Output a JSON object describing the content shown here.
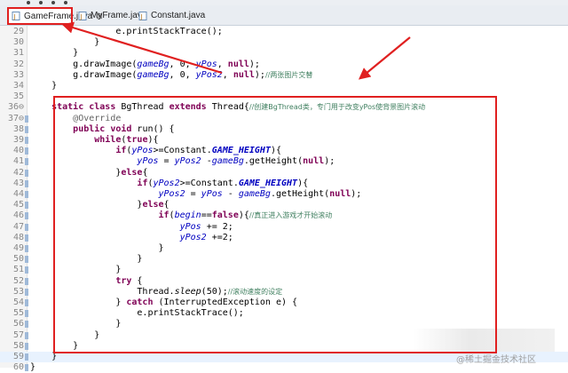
{
  "tabs": [
    {
      "label": "GameFrame.java",
      "close": "⊠",
      "active": true
    },
    {
      "label": "MyFrame.java",
      "active": false
    },
    {
      "label": "Constant.java",
      "active": false
    }
  ],
  "lines": [
    {
      "num": "29",
      "code": [
        [
          "",
          "                e.printStackTrace();"
        ]
      ]
    },
    {
      "num": "30",
      "code": [
        [
          "",
          "            }"
        ]
      ]
    },
    {
      "num": "31",
      "code": [
        [
          "",
          "        }"
        ]
      ]
    },
    {
      "num": "32",
      "code": [
        [
          "",
          "        g.drawImage("
        ],
        [
          "fld",
          "gameBg"
        ],
        [
          "",
          ", 0, "
        ],
        [
          "fld",
          "yPos"
        ],
        [
          "",
          ", "
        ],
        [
          "kw",
          "null"
        ],
        [
          "",
          ");"
        ]
      ]
    },
    {
      "num": "33",
      "code": [
        [
          "",
          "        g.drawImage("
        ],
        [
          "fld",
          "gameBg"
        ],
        [
          "",
          ", 0, "
        ],
        [
          "fld",
          "yPos2"
        ],
        [
          "",
          ", "
        ],
        [
          "kw",
          "null"
        ],
        [
          "",
          ");"
        ],
        [
          "cmt",
          "//两张图片交替"
        ]
      ]
    },
    {
      "num": "34",
      "code": [
        [
          "",
          "    }"
        ]
      ]
    },
    {
      "num": "35",
      "code": [
        [
          "",
          ""
        ]
      ]
    },
    {
      "num": "36⊖",
      "code": [
        [
          "",
          "    "
        ],
        [
          "kw",
          "static class"
        ],
        [
          "",
          " BgThread "
        ],
        [
          "kw",
          "extends"
        ],
        [
          "",
          " Thread{"
        ],
        [
          "cmt",
          "//创建BgThread类，专门用于改变yPos使背景图片滚动"
        ]
      ]
    },
    {
      "num": "37⊖",
      "code": [
        [
          "",
          "        "
        ],
        [
          "ann",
          "@Override"
        ]
      ]
    },
    {
      "num": "38",
      "code": [
        [
          "",
          "        "
        ],
        [
          "kw",
          "public void"
        ],
        [
          "",
          " run() {"
        ]
      ]
    },
    {
      "num": "39",
      "code": [
        [
          "",
          "            "
        ],
        [
          "kw",
          "while"
        ],
        [
          "",
          "("
        ],
        [
          "kw",
          "true"
        ],
        [
          "",
          "){"
        ]
      ]
    },
    {
      "num": "40",
      "code": [
        [
          "",
          "                "
        ],
        [
          "kw",
          "if"
        ],
        [
          "",
          "("
        ],
        [
          "fld",
          "yPos"
        ],
        [
          "",
          ">=Constant."
        ],
        [
          "sfld",
          "GAME_HEIGHT"
        ],
        [
          "",
          "){"
        ]
      ]
    },
    {
      "num": "41",
      "code": [
        [
          "",
          "                    "
        ],
        [
          "fld",
          "yPos"
        ],
        [
          "",
          " = "
        ],
        [
          "fld",
          "yPos2"
        ],
        [
          "",
          " -"
        ],
        [
          "fld",
          "gameBg"
        ],
        [
          "",
          ".getHeight("
        ],
        [
          "kw",
          "null"
        ],
        [
          "",
          ");"
        ]
      ]
    },
    {
      "num": "42",
      "code": [
        [
          "",
          "                }"
        ],
        [
          "kw",
          "else"
        ],
        [
          "",
          "{"
        ]
      ]
    },
    {
      "num": "43",
      "code": [
        [
          "",
          "                    "
        ],
        [
          "kw",
          "if"
        ],
        [
          "",
          "("
        ],
        [
          "fld",
          "yPos2"
        ],
        [
          "",
          ">=Constant."
        ],
        [
          "sfld",
          "GAME_HEIGHT"
        ],
        [
          "",
          "){"
        ]
      ]
    },
    {
      "num": "44",
      "code": [
        [
          "",
          "                        "
        ],
        [
          "fld",
          "yPos2"
        ],
        [
          "",
          " = "
        ],
        [
          "fld",
          "yPos"
        ],
        [
          "",
          " - "
        ],
        [
          "fld",
          "gameBg"
        ],
        [
          "",
          ".getHeight("
        ],
        [
          "kw",
          "null"
        ],
        [
          "",
          ");"
        ]
      ]
    },
    {
      "num": "45",
      "code": [
        [
          "",
          "                    }"
        ],
        [
          "kw",
          "else"
        ],
        [
          "",
          "{"
        ]
      ]
    },
    {
      "num": "46",
      "code": [
        [
          "",
          "                        "
        ],
        [
          "kw",
          "if"
        ],
        [
          "",
          "("
        ],
        [
          "fld",
          "begin"
        ],
        [
          "",
          "=="
        ],
        [
          "kw",
          "false"
        ],
        [
          "",
          "){"
        ],
        [
          "cmt",
          "//真正进入游戏才开始滚动"
        ]
      ]
    },
    {
      "num": "47",
      "code": [
        [
          "",
          "                            "
        ],
        [
          "fld",
          "yPos"
        ],
        [
          "",
          " += 2;"
        ]
      ]
    },
    {
      "num": "48",
      "code": [
        [
          "",
          "                            "
        ],
        [
          "fld",
          "yPos2"
        ],
        [
          "",
          " +=2;"
        ]
      ]
    },
    {
      "num": "49",
      "code": [
        [
          "",
          "                        }"
        ]
      ]
    },
    {
      "num": "50",
      "code": [
        [
          "",
          "                    }"
        ]
      ]
    },
    {
      "num": "51",
      "code": [
        [
          "",
          "                }"
        ]
      ]
    },
    {
      "num": "52",
      "code": [
        [
          "",
          "                "
        ],
        [
          "kw",
          "try"
        ],
        [
          "",
          " {"
        ]
      ]
    },
    {
      "num": "53",
      "code": [
        [
          "",
          "                    Thread."
        ],
        [
          "smeth",
          "sleep"
        ],
        [
          "",
          "(50);"
        ],
        [
          "cmt",
          "//滚动速度的设定"
        ]
      ]
    },
    {
      "num": "54",
      "code": [
        [
          "",
          "                } "
        ],
        [
          "kw",
          "catch"
        ],
        [
          "",
          " (InterruptedException e) {"
        ]
      ]
    },
    {
      "num": "55",
      "code": [
        [
          "",
          "                    e.printStackTrace();"
        ]
      ]
    },
    {
      "num": "56",
      "code": [
        [
          "",
          "                }"
        ]
      ]
    },
    {
      "num": "57",
      "code": [
        [
          "",
          "            }"
        ]
      ]
    },
    {
      "num": "58",
      "code": [
        [
          "",
          "        }"
        ]
      ]
    },
    {
      "num": "59",
      "code": [
        [
          "",
          "    }"
        ]
      ]
    },
    {
      "num": "60",
      "code": [
        [
          "",
          "}"
        ]
      ]
    }
  ],
  "current_line": "59",
  "watermark": "@稀土掘金技术社区",
  "colors": {
    "annotation_red": "#e02020",
    "keyword": "#7f0055",
    "field": "#0000c0",
    "comment": "#3f7f5f"
  }
}
